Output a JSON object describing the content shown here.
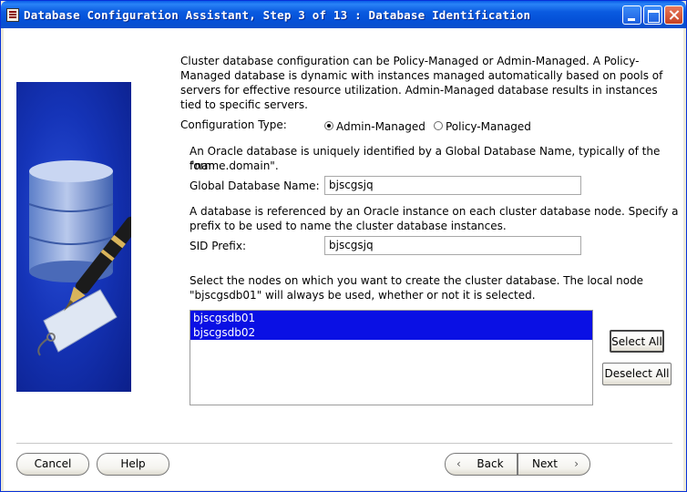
{
  "window": {
    "title": "Database Configuration Assistant, Step 3 of 13 : Database Identification"
  },
  "intro": {
    "line1": "Cluster database configuration can be Policy-Managed or Admin-Managed. A Policy-",
    "line2": "Managed database is dynamic with instances managed automatically based on pools of",
    "line3": "servers for effective resource utilization. Admin-Managed database results in instances",
    "line4": "tied to specific servers."
  },
  "config_type": {
    "label": "Configuration Type:",
    "options": [
      "Admin-Managed",
      "Policy-Managed"
    ],
    "selected": "Admin-Managed"
  },
  "gdb": {
    "desc_line1": "An Oracle database is uniquely identified by a Global Database Name, typically of the form",
    "desc_line2": "\"name.domain\".",
    "label": "Global Database Name:",
    "value": "bjscgsjq"
  },
  "sid": {
    "desc_line1": "A database is referenced by an Oracle instance on each cluster database node. Specify a",
    "desc_line2": "prefix to be used to name the cluster database instances.",
    "label": "SID Prefix:",
    "value": "bjscgsjq"
  },
  "nodes": {
    "desc_line1": "Select the nodes on which you want to create the cluster database. The local node",
    "desc_line2": "\"bjscgsdb01\" will always be used, whether or not it is selected.",
    "items": [
      "bjscgsdb01",
      "bjscgsdb02"
    ],
    "select_all": "Select All",
    "deselect_all": "Deselect All"
  },
  "footer": {
    "cancel": "Cancel",
    "help": "Help",
    "back": "Back",
    "next": "Next"
  }
}
